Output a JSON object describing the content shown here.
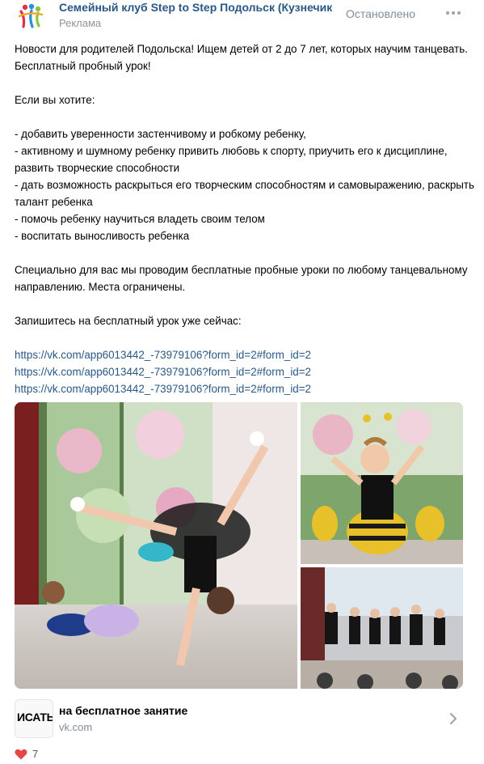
{
  "header": {
    "club_name": "Семейный клуб Step to Step Подольск (Кузнечики)",
    "ad_label": "Реклама",
    "status": "Остановлено"
  },
  "post": {
    "intro": "Новости для родителей Подольска! Ищем детей от 2 до 7 лет, которых научим танцевать. Бесплатный пробный урок!",
    "if_you_want": "Если вы хотите:",
    "bullets": [
      "- добавить уверенности застенчивому и робкому ребенку,",
      "- активному и шумному ребенку привить любовь к спорту, приучить его к дисциплине, развить творческие способности",
      "- дать возможность раскрыться его творческим способностям и самовыражению, раскрыть талант ребенка",
      "- помочь ребенку научиться владеть своим телом",
      "- воспитать выносливость ребенка"
    ],
    "special": "Специально для вас мы проводим бесплатные пробные уроки по любому танцевальному направлению. Места ограничены.",
    "signup": "Запишитесь на бесплатный урок уже сейчас:",
    "links": [
      "https://vk.com/app6013442_-73979106?form_id=2#form_id=2",
      "https://vk.com/app6013442_-73979106?form_id=2#form_id=2",
      "https://vk.com/app6013442_-73979106?form_id=2#form_id=2"
    ]
  },
  "card": {
    "thumb_text": "ИСАТЬ",
    "title": "на бесплатное занятие",
    "domain": "vk.com"
  },
  "footer": {
    "likes": "7"
  },
  "colors": {
    "link": "#2a5885",
    "muted": "#818c99",
    "heart": "#e64646"
  }
}
